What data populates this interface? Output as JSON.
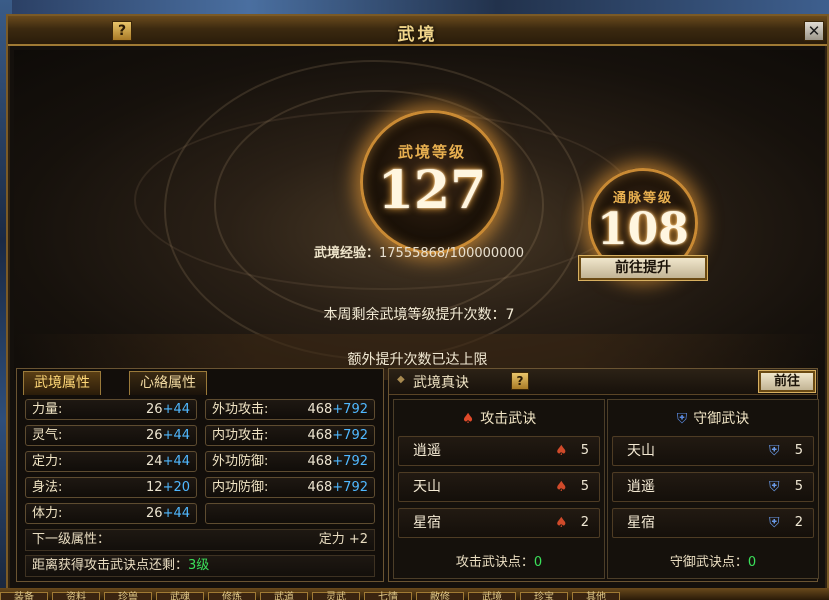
{
  "window": {
    "title": "武境"
  },
  "hero": {
    "main_orb": {
      "label": "武境等级",
      "value": "127"
    },
    "side_orb": {
      "label": "通脉等级",
      "value": "108"
    },
    "exp_label": "武境经验：",
    "exp_value": "17555868/100000000",
    "goto_button": "前往提升",
    "weekly_text": "本周剩余武境等级提升次数：7",
    "limit_text": "额外提升次数已达上限"
  },
  "attr_panel": {
    "tabs": [
      "武境属性",
      "心絡属性"
    ],
    "stats": [
      {
        "name": "力量:",
        "base": "26",
        "bonus": "+44"
      },
      {
        "name": "外功攻击:",
        "base": "468",
        "bonus": "+792"
      },
      {
        "name": "灵气:",
        "base": "26",
        "bonus": "+44"
      },
      {
        "name": "内功攻击:",
        "base": "468",
        "bonus": "+792"
      },
      {
        "name": "定力:",
        "base": "24",
        "bonus": "+44"
      },
      {
        "name": "外功防御:",
        "base": "468",
        "bonus": "+792"
      },
      {
        "name": "身法:",
        "base": "12",
        "bonus": "+20"
      },
      {
        "name": "内功防御:",
        "base": "468",
        "bonus": "+792"
      },
      {
        "name": "体力:",
        "base": "26",
        "bonus": "+44"
      }
    ],
    "next_level_label": "下一级属性：",
    "next_level_value": "定力 +2",
    "distance_label": "距离获得攻击武诀点还剩：",
    "distance_value": "3级"
  },
  "martial_panel": {
    "title": "武境真诀",
    "goto_button": "前往",
    "attack": {
      "title": "攻击武诀",
      "skills": [
        {
          "name": "逍遥",
          "level": "5"
        },
        {
          "name": "天山",
          "level": "5"
        },
        {
          "name": "星宿",
          "level": "2"
        }
      ],
      "points_label": "攻击武诀点：",
      "points_value": "0"
    },
    "defense": {
      "title": "守御武诀",
      "skills": [
        {
          "name": "天山",
          "level": "5"
        },
        {
          "name": "逍遥",
          "level": "5"
        },
        {
          "name": "星宿",
          "level": "2"
        }
      ],
      "points_label": "守御武诀点：",
      "points_value": "0"
    }
  },
  "bottom_bar": {
    "items": [
      "装备",
      "资料",
      "珍兽",
      "武魂",
      "修炼",
      "武道",
      "灵武",
      "七情",
      "敝修",
      "武境",
      "珍宝",
      "其他"
    ]
  },
  "colors": {
    "accent": "#c98a34",
    "bonus": "#50b8ff",
    "points": "#3ae05a"
  }
}
